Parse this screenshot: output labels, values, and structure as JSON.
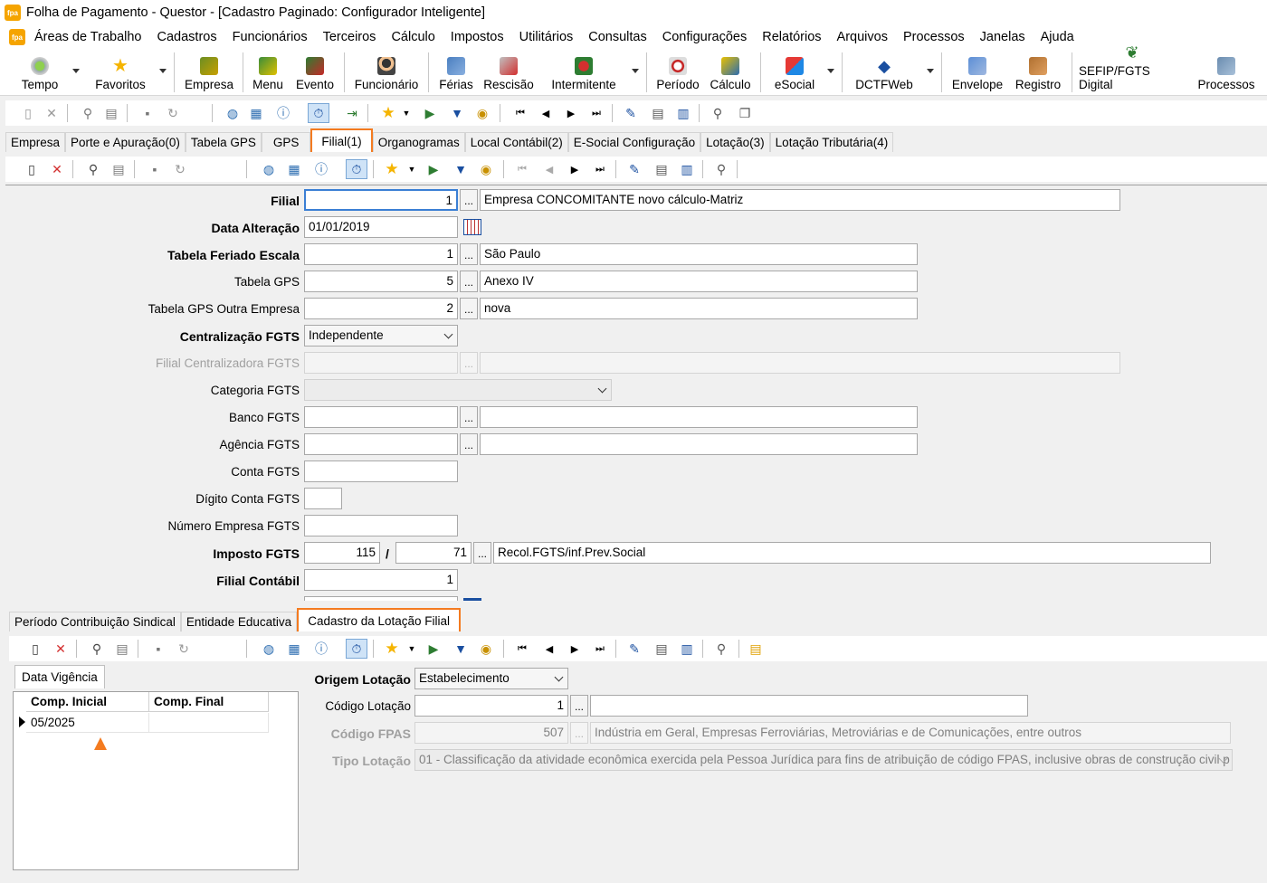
{
  "window": {
    "title": "Folha de Pagamento - Questor - [Cadastro Paginado: Configurador Inteligente]",
    "app_icon": "fpa"
  },
  "menu": [
    "Áreas de Trabalho",
    "Cadastros",
    "Funcionários",
    "Terceiros",
    "Cálculo",
    "Impostos",
    "Utilitários",
    "Consultas",
    "Configurações",
    "Relatórios",
    "Arquivos",
    "Processos",
    "Janelas",
    "Ajuda"
  ],
  "toolbar": {
    "tempo": "Tempo",
    "favoritos": "Favoritos",
    "empresa": "Empresa",
    "menu": "Menu",
    "evento": "Evento",
    "funcionario": "Funcionário",
    "ferias": "Férias",
    "rescisao": "Rescisão",
    "intermitente": "Intermitente",
    "periodo": "Período",
    "calculo": "Cálculo",
    "esocial": "eSocial",
    "dctfweb": "DCTFWeb",
    "envelope": "Envelope",
    "registro": "Registro",
    "sefip": "SEFIP/FGTS Digital",
    "processos": "Processos"
  },
  "tabs_top": [
    "Empresa",
    "Porte e Apuração(0)",
    "Tabela GPS",
    "GPS",
    "Filial(1)",
    "Organogramas",
    "Local Contábil(2)",
    "E-Social Configuração",
    "Lotação(3)",
    "Lotação Tributária(4)"
  ],
  "form": {
    "filial": {
      "label": "Filial",
      "code": "1",
      "desc": "Empresa CONCOMITANTE novo cálculo-Matriz"
    },
    "data_alteracao": {
      "label": "Data Alteração",
      "value": "01/01/2019"
    },
    "tabela_feriado": {
      "label": "Tabela Feriado Escala",
      "code": "1",
      "desc": "São Paulo"
    },
    "tabela_gps": {
      "label": "Tabela GPS",
      "code": "5",
      "desc": "Anexo IV"
    },
    "tabela_gps_outra": {
      "label": "Tabela GPS Outra Empresa",
      "code": "2",
      "desc": "nova"
    },
    "centralizacao": {
      "label": "Centralização FGTS",
      "value": "Independente"
    },
    "filial_centralizadora": {
      "label": "Filial Centralizadora FGTS"
    },
    "categoria": {
      "label": "Categoria FGTS"
    },
    "banco": {
      "label": "Banco FGTS"
    },
    "agencia": {
      "label": "Agência FGTS"
    },
    "conta": {
      "label": "Conta FGTS"
    },
    "digito": {
      "label": "Dígito Conta FGTS"
    },
    "numero_empresa": {
      "label": "Número Empresa FGTS"
    },
    "imposto": {
      "label": "Imposto FGTS",
      "code1": "115",
      "sep": "/",
      "code2": "71",
      "desc": "Recol.FGTS/inf.Prev.Social"
    },
    "filial_contabil": {
      "label": "Filial Contábil",
      "value": "1"
    }
  },
  "tabs_bottom": [
    "Período Contribuição Sindical",
    "Entidade Educativa",
    "Cadastro da Lotação Filial"
  ],
  "vigencia": {
    "tab": "Data Vigência",
    "col1": "Comp. Inicial",
    "col2": "Comp. Final",
    "rows": [
      {
        "inicial": "05/2025",
        "final": ""
      }
    ]
  },
  "lotacao": {
    "origem": {
      "label": "Origem Lotação",
      "value": "Estabelecimento"
    },
    "codigo": {
      "label": "Código Lotação",
      "value": "1"
    },
    "fpas": {
      "label": "Código FPAS",
      "value": "507",
      "desc": "Indústria em Geral, Empresas Ferroviárias, Metroviárias e de Comunicações, entre outros"
    },
    "tipo": {
      "label": "Tipo Lotação",
      "value": "01 - Classificação da atividade econômica exercida pela Pessoa Jurídica para fins de atribuição de código FPAS, inclusive obras de construção civil p"
    }
  },
  "colors": {
    "highlight": "#f47b20",
    "focus": "#3b7fd4"
  }
}
